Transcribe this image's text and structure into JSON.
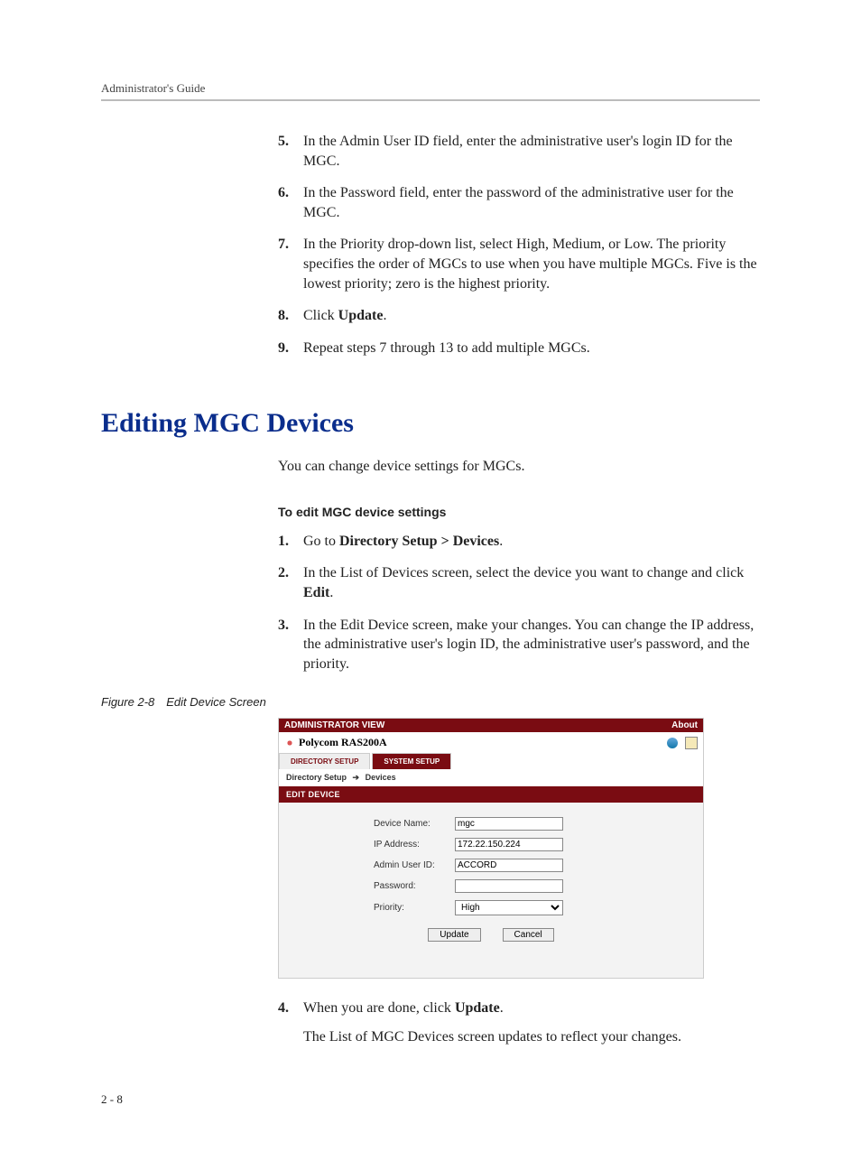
{
  "header": {
    "running_head": "Administrator's Guide"
  },
  "steps_top": [
    {
      "n": "5.",
      "html": "In the Admin User ID field, enter the administrative user's login ID for the MGC."
    },
    {
      "n": "6.",
      "html": "In the Password field, enter the password of the administrative user for the MGC."
    },
    {
      "n": "7.",
      "html": "In the Priority drop-down list, select High, Medium, or Low. The priority specifies the order of MGCs to use when you have multiple MGCs. Five is the lowest priority; zero is the highest priority."
    },
    {
      "n": "8.",
      "html": "Click <b>Update</b>."
    },
    {
      "n": "9.",
      "html": "Repeat steps 7 through 13 to add multiple MGCs."
    }
  ],
  "section_title": "Editing MGC Devices",
  "intro": "You can change device settings for MGCs.",
  "subhead": "To edit MGC device settings",
  "steps_mid": [
    {
      "n": "1.",
      "html": "Go to <b>Directory Setup > Devices</b>."
    },
    {
      "n": "2.",
      "html": "In the List of Devices screen, select the device you want to change and click <b>Edit</b>."
    },
    {
      "n": "3.",
      "html": "In the Edit Device screen, make your changes. You can change the IP address, the administrative user's login ID, the administrative user's password, and the priority."
    }
  ],
  "figure_caption": "Figure 2-8 Edit Device Screen",
  "screenshot": {
    "title": "ADMINISTRATOR VIEW",
    "about": "About",
    "product": "Polycom RAS200A",
    "tab_active": "DIRECTORY SETUP",
    "tab_inactive": "SYSTEM SETUP",
    "breadcrumb": {
      "a": "Directory Setup",
      "b": "Devices"
    },
    "panel_title": "EDIT DEVICE",
    "labels": {
      "device_name": "Device Name:",
      "ip": "IP Address:",
      "user": "Admin User ID:",
      "pwd": "Password:",
      "priority": "Priority:"
    },
    "values": {
      "device_name": "mgc",
      "ip": "172.22.150.224",
      "user": "ACCORD",
      "pwd": "",
      "priority": "High"
    },
    "buttons": {
      "update": "Update",
      "cancel": "Cancel"
    }
  },
  "steps_after": [
    {
      "n": "4.",
      "html": "When you are done, click <b>Update</b>."
    }
  ],
  "after_step_para": "The List of MGC Devices screen updates to reflect your changes.",
  "page_number": "2 - 8"
}
